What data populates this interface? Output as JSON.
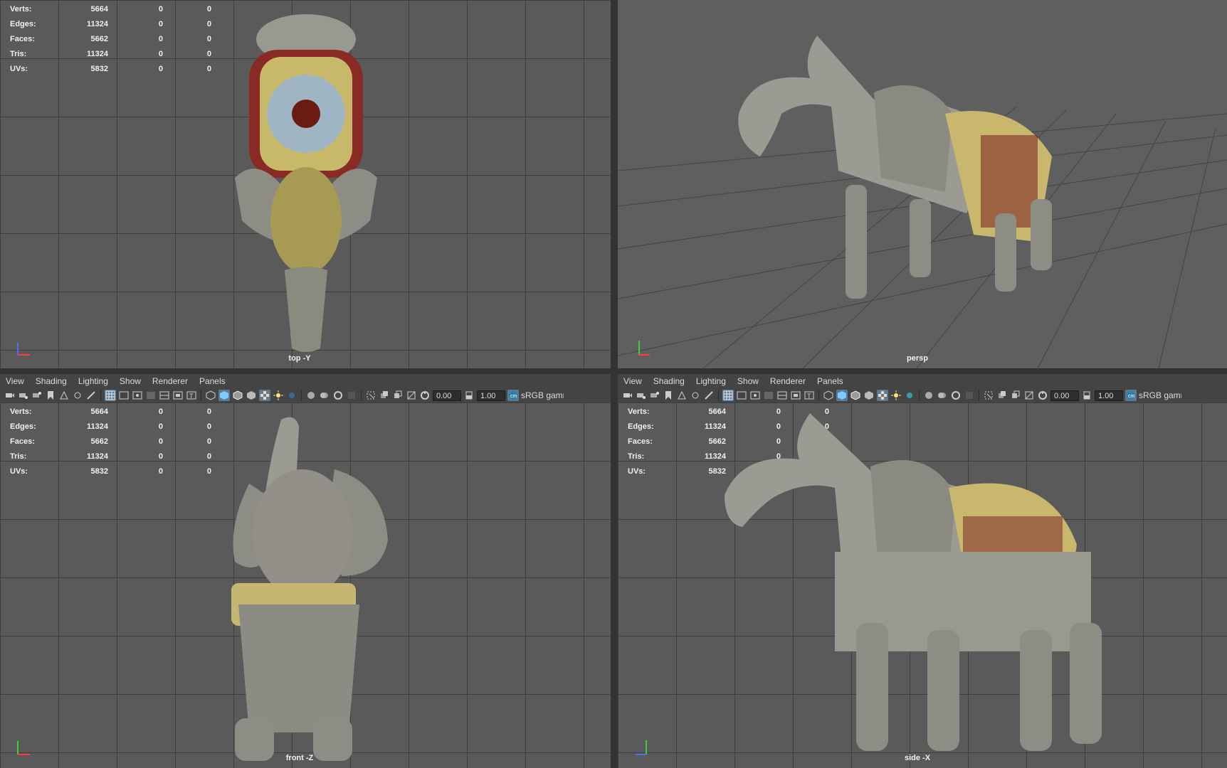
{
  "stats": [
    {
      "label": "Verts:",
      "a": "5664",
      "b": "0",
      "c": "0"
    },
    {
      "label": "Edges:",
      "a": "11324",
      "b": "0",
      "c": "0"
    },
    {
      "label": "Faces:",
      "a": "5662",
      "b": "0",
      "c": "0"
    },
    {
      "label": "Tris:",
      "a": "11324",
      "b": "0",
      "c": "0"
    },
    {
      "label": "UVs:",
      "a": "5832",
      "b": "0",
      "c": "0"
    }
  ],
  "viewports": {
    "top": "top -Y",
    "persp": "persp",
    "front": "front -Z",
    "side": "side -X"
  },
  "menu": [
    "View",
    "Shading",
    "Lighting",
    "Show",
    "Renderer",
    "Panels"
  ],
  "toolbar": {
    "field_a": "0.00",
    "field_b": "1.00",
    "color_space": "sRGB gamma"
  },
  "icons": [
    "camera-icon",
    "bookmark-icon",
    "wireframe-icon",
    "smooth-shade-icon",
    "texture-icon",
    "light-icon",
    "isolate-icon",
    "grid-icon",
    "xray-icon",
    "exposure-icon",
    "gamma-icon",
    "color-space-icon"
  ],
  "colors": {
    "viewport_bg": "#5a5a5a",
    "grid": "#3f3f3f",
    "panel": "#444444",
    "active_button": "#5a7a9a"
  }
}
